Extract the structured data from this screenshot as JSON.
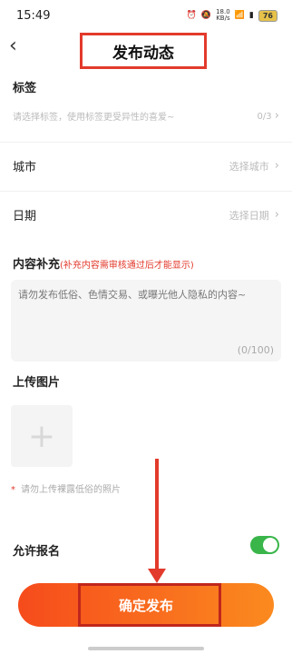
{
  "status_bar": {
    "time": "15:49",
    "net_speed_top": "18.0",
    "net_speed_bottom": "KB/s",
    "battery": "76"
  },
  "nav": {
    "back_icon": "chevron-left-icon",
    "title": "发布动态"
  },
  "tags": {
    "label": "标签",
    "placeholder": "请选择标签，使用标签更受异性的喜爱~",
    "count": "0/3"
  },
  "city": {
    "label": "城市",
    "value": "选择城市"
  },
  "date": {
    "label": "日期",
    "value": "选择日期"
  },
  "content": {
    "label": "内容补充",
    "note": "(补充内容需审核通过后才能显示)",
    "placeholder": "请勿发布低俗、色情交易、或曝光他人隐私的内容~",
    "counter": "(0/100)"
  },
  "upload": {
    "label": "上传图片",
    "tip": "请勿上传裸露低俗的照片"
  },
  "allow_signup": {
    "label": "允许报名",
    "enabled": true
  },
  "submit": {
    "label": "确定发布"
  },
  "colors": {
    "accent": "#e23a2c",
    "button_start": "#f64b1c",
    "button_end": "#fb8a1f",
    "toggle_on": "#39b54a"
  }
}
